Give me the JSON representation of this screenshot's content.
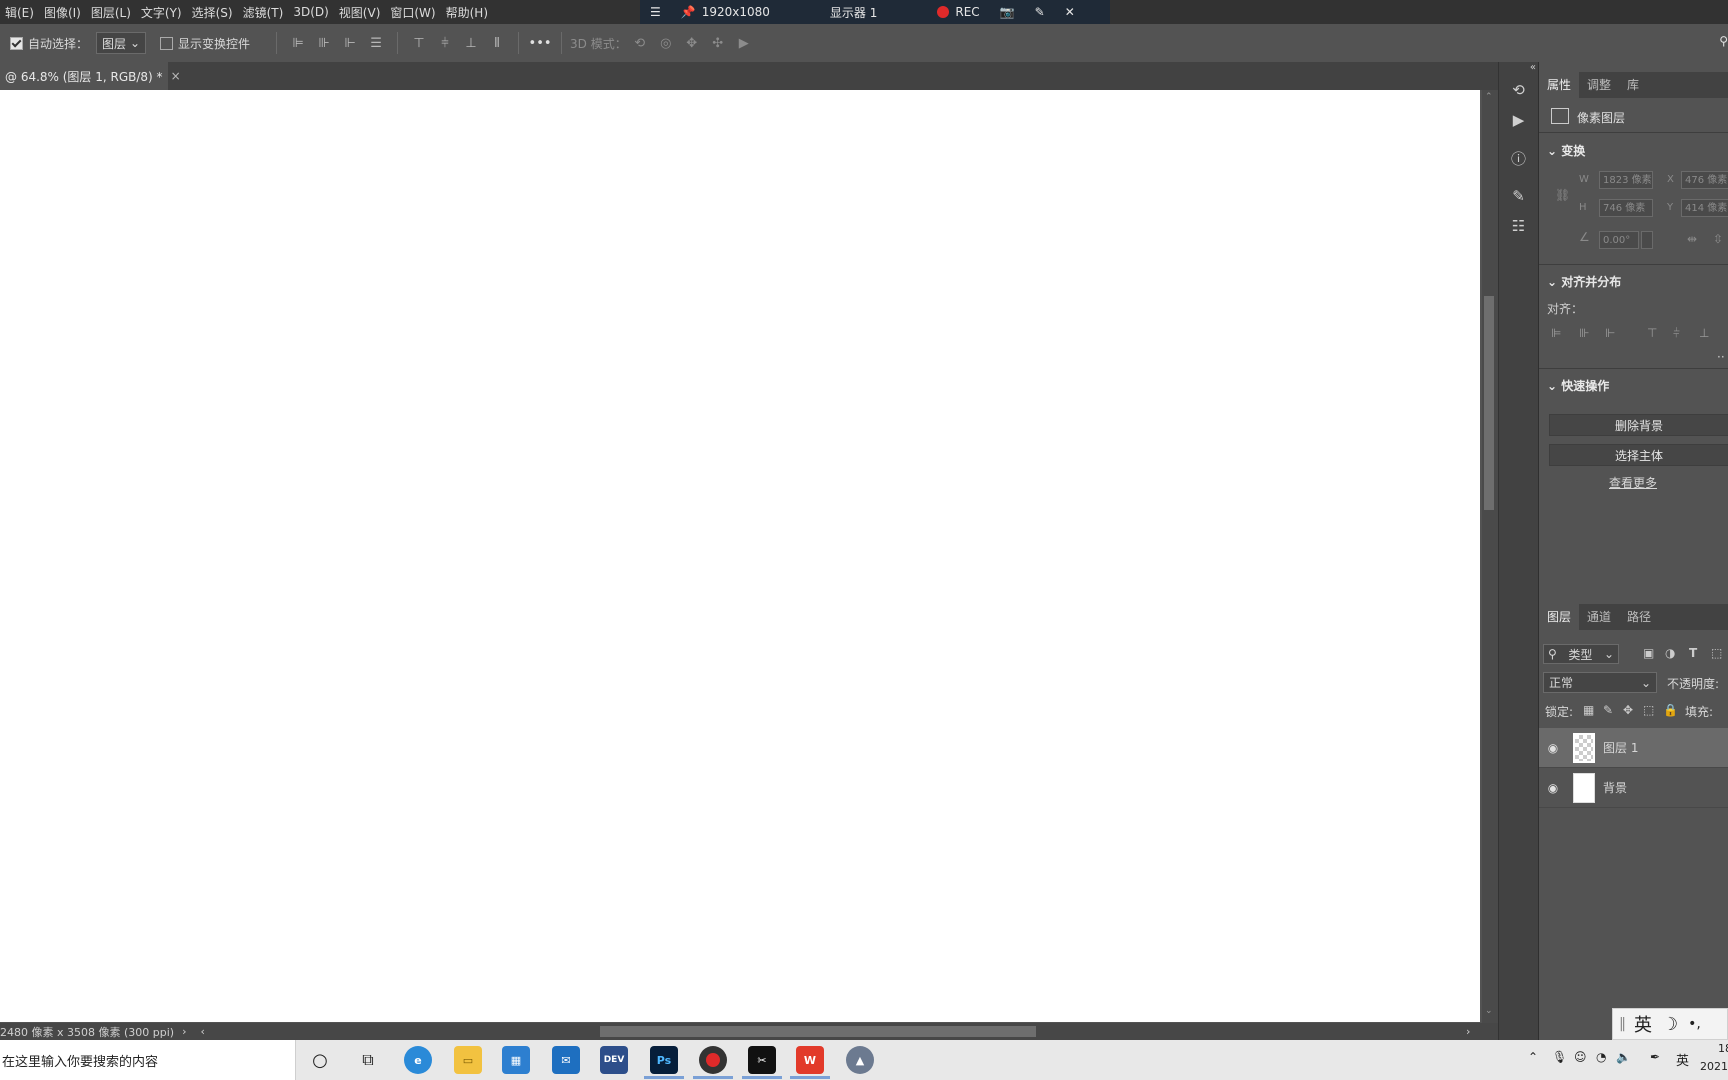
{
  "menu": [
    "辑(E)",
    "图像(I)",
    "图层(L)",
    "文字(Y)",
    "选择(S)",
    "滤镜(T)",
    "3D(D)",
    "视图(V)",
    "窗口(W)",
    "帮助(H)"
  ],
  "recorder": {
    "resolution": "1920x1080",
    "display": "显示器 1",
    "rec": "REC"
  },
  "options": {
    "auto_select": "自动选择：",
    "target": "图层",
    "show_transform": "显示变换控件",
    "mode_3d": "3D 模式："
  },
  "document": {
    "tab": "@ 64.8% (图层 1, RGB/8) *",
    "status": "2480 像素 x 3508 像素 (300 ppi)"
  },
  "properties": {
    "tabs": [
      "属性",
      "调整",
      "库"
    ],
    "kind": "像素图层",
    "transform_title": "变换",
    "w_label": "W",
    "w": "1823 像素",
    "x_label": "X",
    "x": "476 像素",
    "h_label": "H",
    "h": "746 像素",
    "y_label": "Y",
    "y": "414 像素",
    "angle": "0.00°",
    "align_title": "对齐并分布",
    "align_label": "对齐：",
    "quick_title": "快速操作",
    "remove_bg": "删除背景",
    "select_subject": "选择主体",
    "see_more": "查看更多"
  },
  "layers_panel": {
    "tabs": [
      "图层",
      "通道",
      "路径"
    ],
    "filter": "类型",
    "blend": "正常",
    "opacity_label": "不透明度:",
    "lock_label": "锁定:",
    "fill_label": "填充:",
    "layers": [
      {
        "name": "图层 1",
        "selected": true
      },
      {
        "name": "背景",
        "selected": false
      }
    ]
  },
  "taskbar": {
    "search": "在这里输入你要搜索的内容",
    "ime": "英",
    "ime_float": "英",
    "clock_time": "18",
    "clock_date": "2021"
  },
  "colors": {
    "accent": "#e02a2a",
    "panel": "#535353",
    "dark": "#323232"
  }
}
